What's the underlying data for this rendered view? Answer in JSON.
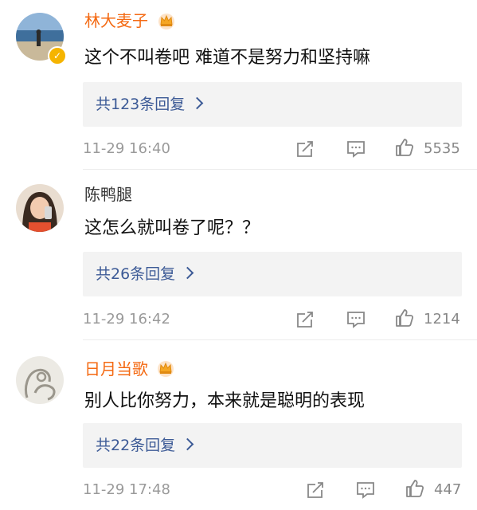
{
  "comments": [
    {
      "username": "林大麦子",
      "vip": true,
      "verified": true,
      "text": "这个不叫卷吧 难道不是努力和坚持嘛",
      "replies": "共123条回复",
      "time": "11-29 16:40",
      "likes": "5535"
    },
    {
      "username": "陈鸭腿",
      "vip": false,
      "verified": false,
      "text": "这怎么就叫卷了呢？？",
      "replies": "共26条回复",
      "time": "11-29 16:42",
      "likes": "1214"
    },
    {
      "username": "日月当歌",
      "vip": true,
      "verified": false,
      "text": "别人比你努力，本来就是聪明的表现",
      "replies": "共22条回复",
      "time": "11-29 17:48",
      "likes": "447"
    }
  ],
  "colors": {
    "vip_name": "#f46a13",
    "reply_link": "#3c5a96",
    "meta": "#9a9a9a"
  },
  "icons": [
    "crown-icon",
    "verified-badge-icon",
    "share-icon",
    "comment-icon",
    "like-icon",
    "chevron-right-icon"
  ]
}
